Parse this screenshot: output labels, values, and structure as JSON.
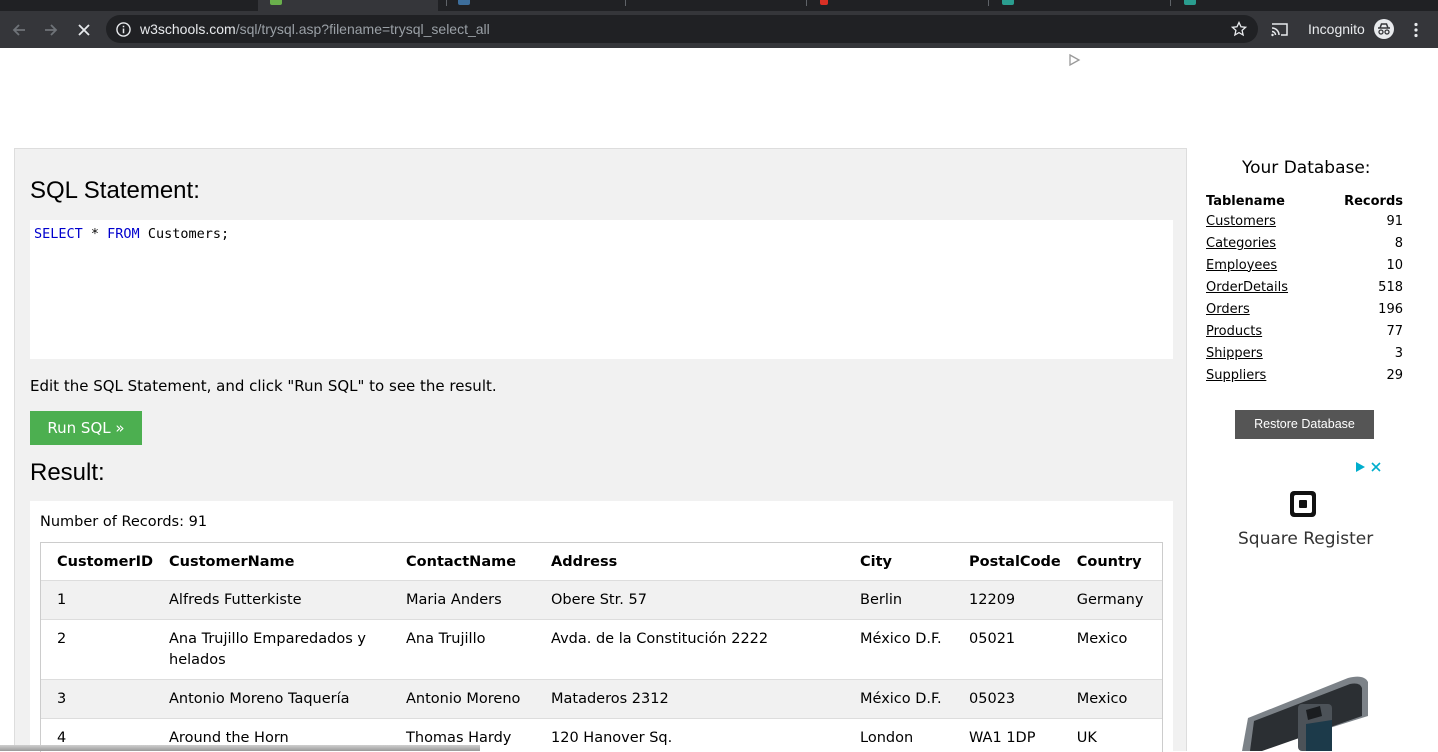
{
  "browser": {
    "url_host": "w3schools.com",
    "url_path": "/sql/trysql.asp?filename=trysql_select_all",
    "profile_label": "Incognito",
    "icons": [
      "back-arrow-icon",
      "forward-arrow-icon",
      "stop-loading-icon",
      "info-icon",
      "star-icon",
      "cast-icon",
      "incognito-icon",
      "kebab-menu-icon"
    ]
  },
  "editor": {
    "heading": "SQL Statement:",
    "kw_select": "SELECT",
    "star": " * ",
    "kw_from": "FROM",
    "rest": " Customers;"
  },
  "hint": "Edit the SQL Statement, and click \"Run SQL\" to see the result.",
  "run_button": "Run SQL »",
  "result": {
    "heading": "Result:",
    "record_count": "Number of Records: 91",
    "columns": [
      "CustomerID",
      "CustomerName",
      "ContactName",
      "Address",
      "City",
      "PostalCode",
      "Country"
    ],
    "rows": [
      [
        "1",
        "Alfreds Futterkiste",
        "Maria Anders",
        "Obere Str. 57",
        "Berlin",
        "12209",
        "Germany"
      ],
      [
        "2",
        "Ana Trujillo Emparedados y helados",
        "Ana Trujillo",
        "Avda. de la Constitución 2222",
        "México D.F.",
        "05021",
        "Mexico"
      ],
      [
        "3",
        "Antonio Moreno Taquería",
        "Antonio Moreno",
        "Mataderos 2312",
        "México D.F.",
        "05023",
        "Mexico"
      ],
      [
        "4",
        "Around the Horn",
        "Thomas Hardy",
        "120 Hanover Sq.",
        "London",
        "WA1 1DP",
        "UK"
      ]
    ]
  },
  "database": {
    "title": "Your Database:",
    "col_table": "Tablename",
    "col_records": "Records",
    "tables": [
      {
        "name": "Customers",
        "records": "91"
      },
      {
        "name": "Categories",
        "records": "8"
      },
      {
        "name": "Employees",
        "records": "10"
      },
      {
        "name": "OrderDetails",
        "records": "518"
      },
      {
        "name": "Orders",
        "records": "196"
      },
      {
        "name": "Products",
        "records": "77"
      },
      {
        "name": "Shippers",
        "records": "3"
      },
      {
        "name": "Suppliers",
        "records": "29"
      }
    ],
    "restore_button": "Restore Database"
  },
  "ad": {
    "product_name": "Square Register",
    "icons": [
      "ad-choices-icon",
      "ad-close-icon",
      "square-logo-icon",
      "register-device-image"
    ]
  },
  "colors": {
    "chrome_dark": "#202124",
    "toolbar": "#35363a",
    "panel_bg": "#f1f1f1",
    "run_green": "#4caf50",
    "restore_gray": "#555555",
    "sql_keyword": "#0000cd",
    "ad_blue": "#00aecd"
  }
}
